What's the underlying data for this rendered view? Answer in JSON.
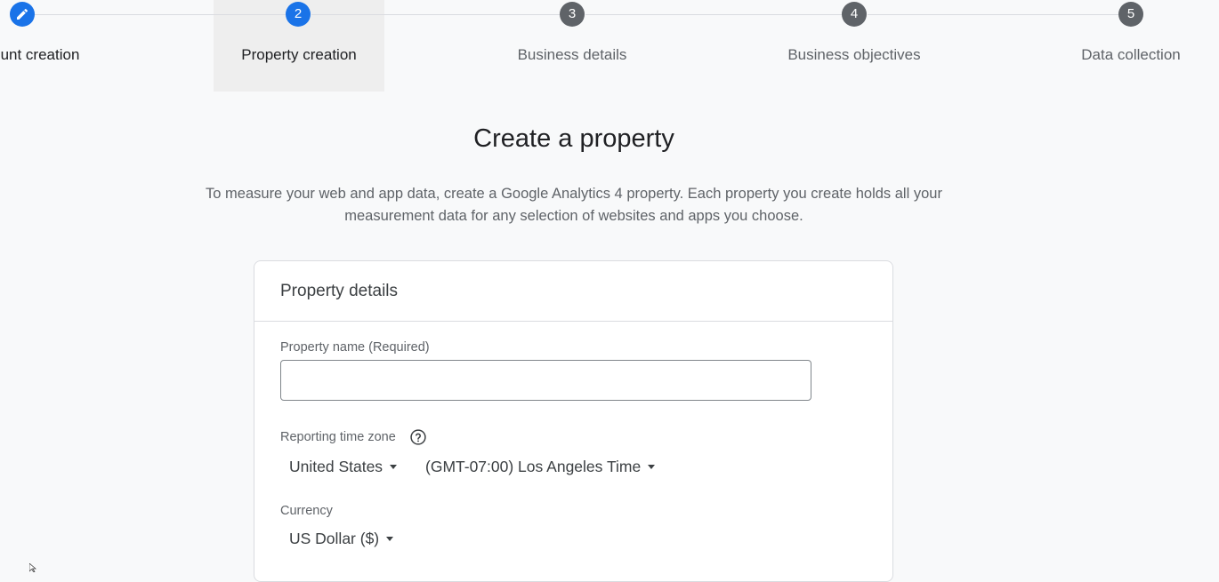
{
  "stepper": {
    "steps": [
      {
        "number": "",
        "label": "unt creation",
        "state": "done",
        "icon": "pencil-icon"
      },
      {
        "number": "2",
        "label": "Property creation",
        "state": "current"
      },
      {
        "number": "3",
        "label": "Business details",
        "state": "pending"
      },
      {
        "number": "4",
        "label": "Business objectives",
        "state": "pending"
      },
      {
        "number": "5",
        "label": "Data collection",
        "state": "pending"
      }
    ]
  },
  "page": {
    "title": "Create a property",
    "description_line1": "To measure your web and app data, create a Google Analytics 4 property. Each property you create holds all your",
    "description_line2": "measurement data for any selection of websites and apps you choose."
  },
  "card": {
    "header": "Property details",
    "property_name": {
      "label": "Property name (Required)",
      "value": "",
      "placeholder": ""
    },
    "time_zone": {
      "label": "Reporting time zone",
      "help_icon": "help-circle-icon",
      "country": "United States",
      "zone": "(GMT-07:00) Los Angeles Time"
    },
    "currency": {
      "label": "Currency",
      "value": "US Dollar ($)"
    }
  },
  "colors": {
    "accent": "#1a73e8",
    "pending_step": "#5f6368",
    "background": "#f8f9fa",
    "current_step_bg": "#eeeeee"
  }
}
